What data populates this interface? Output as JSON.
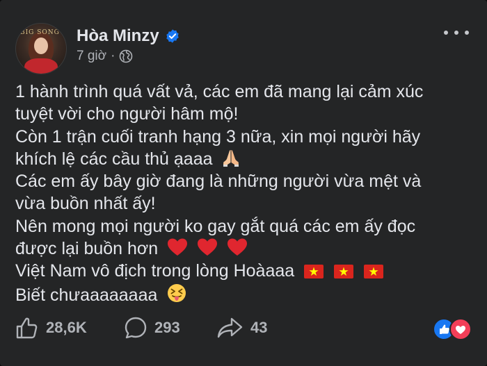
{
  "post": {
    "author": "Hòa Minzy",
    "timestamp": "7 giờ",
    "separator": "·",
    "avatar_text": "BIG SONG",
    "lines": [
      "1 hành trình quá vất vả, các em đã mang lại cảm xúc",
      "tuyệt vời cho người hâm mộ!",
      "Còn 1 trận cuối tranh hạng 3 nữa, xin mọi người hãy",
      "khích lệ các cầu thủ ạaaa",
      "Các em ấy bây giờ đang là những người vừa mệt và",
      "vừa buồn nhất ấy!",
      "Nên mong mọi người ko gay gắt quá các em ấy đọc",
      "được lại buồn hơn",
      "Việt Nam vô địch trong lòng Hoàaaa",
      "Biết chưaaaaaaaa"
    ]
  },
  "actions": {
    "likes": "28,6K",
    "comments": "293",
    "shares": "43"
  },
  "icons": {
    "verified": "verified-badge-icon",
    "audience": "globe-icon",
    "more": "more-options-icon",
    "pray": "folded-hands-emoji",
    "heart": "red-heart-emoji",
    "flag": "vietnam-flag-emoji",
    "tongue": "squinting-tongue-emoji",
    "like": "thumbs-up-icon",
    "comment": "comment-bubble-icon",
    "share": "share-arrow-icon",
    "reaction_like": "like-reaction-icon",
    "reaction_love": "love-reaction-icon"
  },
  "colors": {
    "background": "#242526",
    "text": "#e4e6eb",
    "secondary_text": "#b0b3b8",
    "verified_blue": "#1877f2",
    "love_red": "#f33e58",
    "flag_red": "#da251d",
    "flag_star": "#ffff00"
  }
}
